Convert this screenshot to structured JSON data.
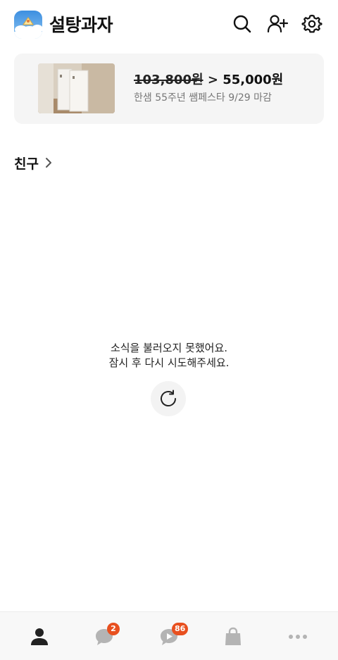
{
  "header": {
    "app_title": "설탕과자",
    "icons": [
      "search-icon",
      "add-friend-icon",
      "settings-icon"
    ]
  },
  "ad": {
    "old_price": "103,800원",
    "arrow": ">",
    "new_price": "55,000원",
    "subtitle": "한샘 55주년 쌤페스타 9/29 마감"
  },
  "friends_section": {
    "title": "친구"
  },
  "error": {
    "line1": "소식을 불러오지 못했어요.",
    "line2": "잠시 후 다시 시도해주세요."
  },
  "bottom_nav": {
    "items": [
      {
        "name": "friends",
        "icon": "person-icon",
        "active": true
      },
      {
        "name": "chats",
        "icon": "chat-bubble-icon",
        "badge": "2"
      },
      {
        "name": "openchat",
        "icon": "openchat-icon",
        "badge": "86"
      },
      {
        "name": "shopping",
        "icon": "shopping-bag-icon"
      },
      {
        "name": "more",
        "icon": "more-dots-icon"
      }
    ]
  },
  "colors": {
    "badge": "#e8501f",
    "banner_bg": "#f5f5f5",
    "nav_bg": "#f8f8f8",
    "inactive_icon": "#b4b4b4",
    "active_icon": "#222222"
  }
}
